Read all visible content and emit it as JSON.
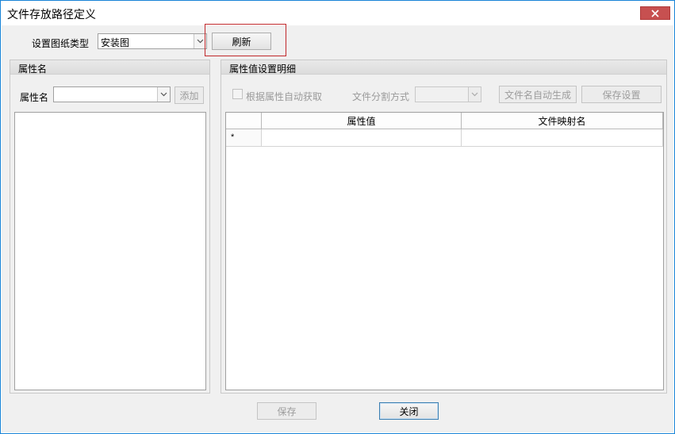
{
  "window": {
    "title": "文件存放路径定义",
    "close_icon": "close-icon"
  },
  "top": {
    "drawing_type_label": "设置图纸类型",
    "drawing_type_value": "安装图",
    "refresh_label": "刷新",
    "highlight_color": "#c0282b"
  },
  "left_panel": {
    "header": "属性名",
    "attr_label": "属性名",
    "attr_value": "",
    "add_label": "添加"
  },
  "right_panel": {
    "header": "属性值设置明细",
    "auto_fetch_label": "根据属性自动获取",
    "auto_fetch_checked": false,
    "split_label": "文件分割方式",
    "split_value": "",
    "auto_gen_label": "文件名自动生成",
    "save_settings_label": "保存设置",
    "grid": {
      "columns": [
        "属性值",
        "文件映射名"
      ],
      "new_row_marker": "*"
    }
  },
  "footer": {
    "save_label": "保存",
    "close_label": "关闭"
  }
}
